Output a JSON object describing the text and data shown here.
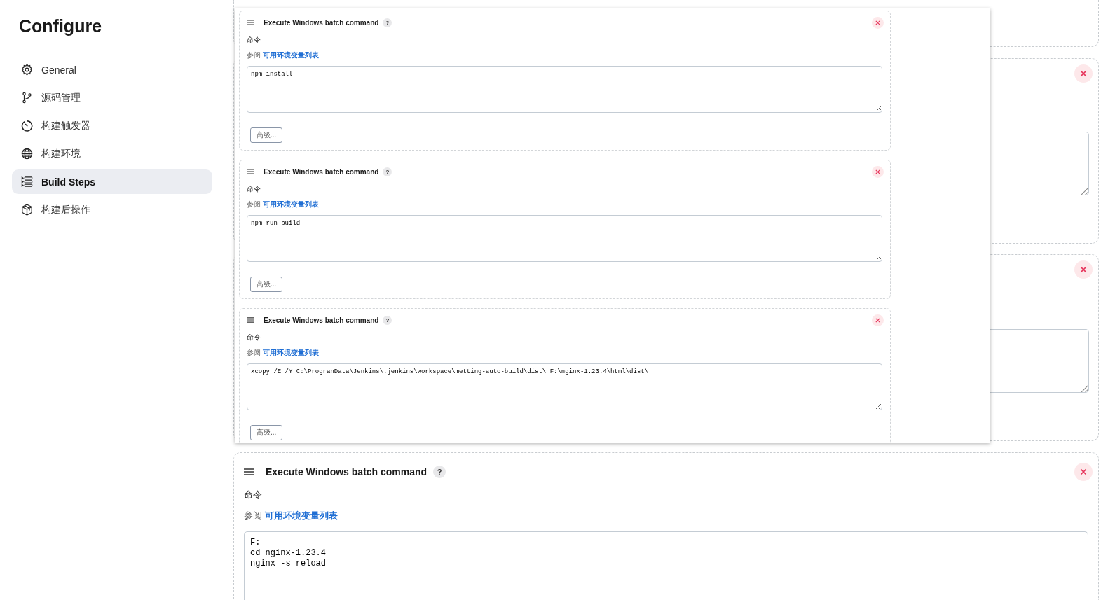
{
  "sidebar": {
    "title": "Configure",
    "items": [
      {
        "label": "General",
        "selected": false
      },
      {
        "label": "源码管理",
        "selected": false
      },
      {
        "label": "构建触发器",
        "selected": false
      },
      {
        "label": "构建环境",
        "selected": false
      },
      {
        "label": "Build Steps",
        "selected": true
      },
      {
        "label": "构建后操作",
        "selected": false
      }
    ]
  },
  "embedded_screenshot": {
    "steps": [
      {
        "title": "Execute Windows batch command",
        "help": "?",
        "label": "命令",
        "see_prefix": "参阅",
        "link": "可用环境变量列表",
        "command": "npm install",
        "advanced_button": "高级..."
      },
      {
        "title": "Execute Windows batch command",
        "help": "?",
        "label": "命令",
        "see_prefix": "参阅",
        "link": "可用环境变量列表",
        "command": "npm run build",
        "advanced_button": "高级..."
      },
      {
        "title": "Execute Windows batch command",
        "help": "?",
        "label": "命令",
        "see_prefix": "参阅",
        "link": "可用环境变量列表",
        "command": "xcopy /E /Y C:\\ProgranData\\Jenkins\\.jenkins\\workspace\\metting-auto-build\\dist\\ F:\\nginx-1.23.4\\html\\dist\\",
        "advanced_button": "高级..."
      }
    ]
  },
  "build_step": {
    "title": "Execute Windows batch command",
    "help": "?",
    "label": "命令",
    "see_prefix": "参阅",
    "link": "可用环境变量列表",
    "command": "F:\ncd nginx-1.23.4\nnginx -s reload"
  }
}
